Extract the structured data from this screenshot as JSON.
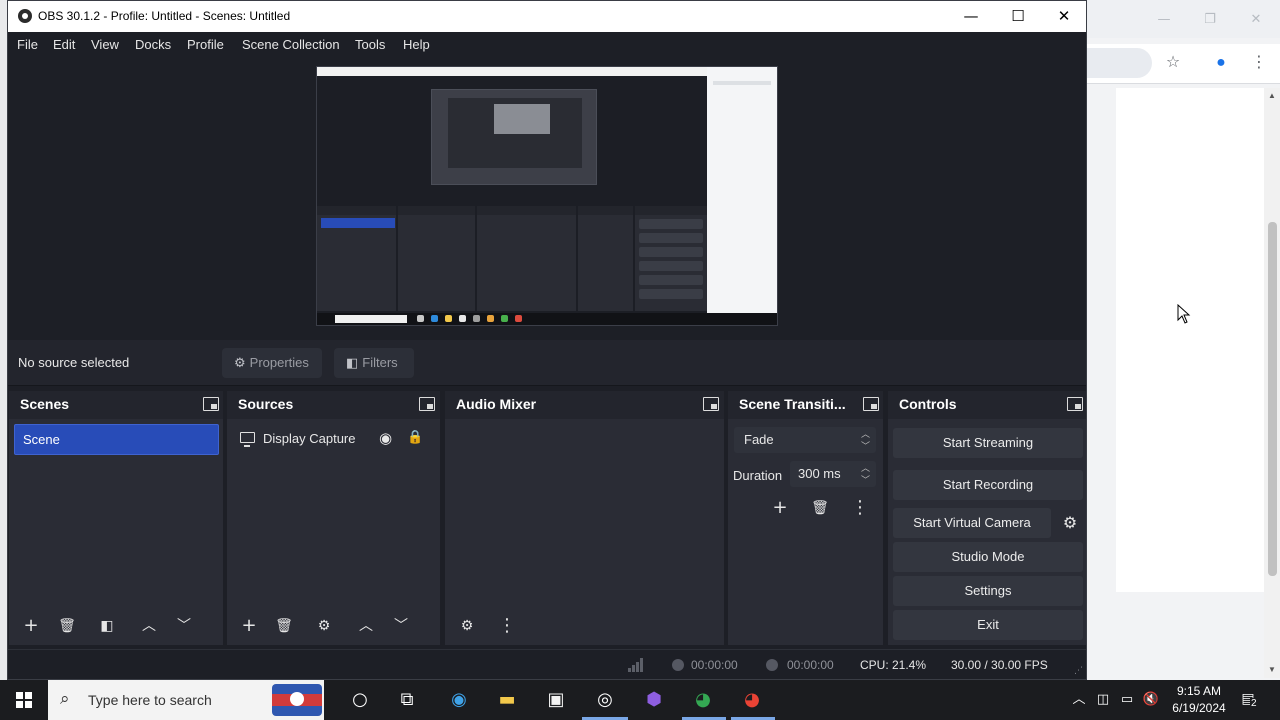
{
  "window": {
    "title": "OBS 30.1.2 - Profile: Untitled - Scenes: Untitled",
    "minimize_glyph": "—",
    "maximize_glyph": "☐",
    "close_glyph": "✕"
  },
  "menu": [
    "File",
    "Edit",
    "View",
    "Docks",
    "Profile",
    "Scene Collection",
    "Tools",
    "Help"
  ],
  "source_toolbar": {
    "status": "No source selected",
    "properties_label": "Properties",
    "filters_label": "Filters"
  },
  "docks": {
    "scenes": {
      "title": "Scenes",
      "items": [
        "Scene"
      ]
    },
    "sources": {
      "title": "Sources",
      "items": [
        {
          "label": "Display Capture",
          "visible": true,
          "locked": true
        }
      ]
    },
    "audio_mixer": {
      "title": "Audio Mixer"
    },
    "scene_transitions": {
      "title": "Scene Transiti...",
      "transition": "Fade",
      "duration_label": "Duration",
      "duration_value": "300 ms"
    },
    "controls": {
      "title": "Controls",
      "start_streaming": "Start Streaming",
      "start_recording": "Start Recording",
      "start_virtual_camera": "Start Virtual Camera",
      "studio_mode": "Studio Mode",
      "settings": "Settings",
      "exit": "Exit"
    }
  },
  "status_bar": {
    "stream_time": "00:00:00",
    "record_time": "00:00:00",
    "cpu": "CPU: 21.4%",
    "fps": "30.00 / 30.00 FPS"
  },
  "taskbar": {
    "search_placeholder": "Type here to search",
    "time": "9:15 AM",
    "date": "6/19/2024",
    "notification_count": "2"
  },
  "icons": {
    "gear": "⚙",
    "plus": "+",
    "trash": "🗑",
    "up": "︿",
    "down": "﹀",
    "kebab": "⋮",
    "eye": "👁",
    "lock": "🔒"
  },
  "colors": {
    "obs_bg": "#1d1f26",
    "dock_bg": "#2a2c35",
    "selected_scene": "#284cb8",
    "button": "#33363f"
  }
}
